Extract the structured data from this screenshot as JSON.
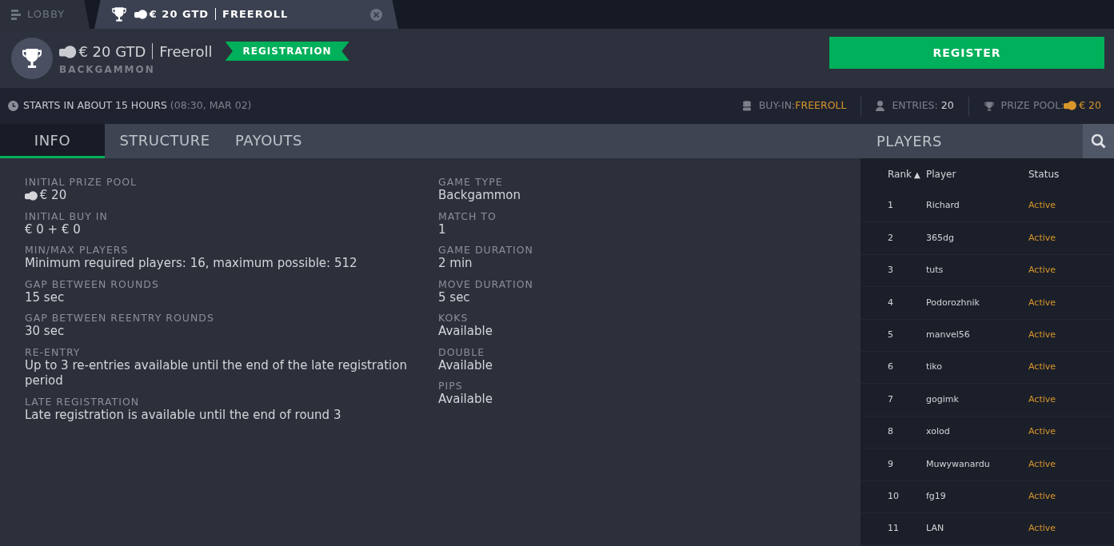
{
  "window_tabs": [
    {
      "kind": "lobby",
      "label": "LOBBY",
      "selected": false
    },
    {
      "kind": "tournament",
      "label": "€ 20 GTD",
      "sublabel": "FREEROLL",
      "selected": true,
      "closable": true
    }
  ],
  "header": {
    "title": "€ 20 GTD",
    "subtitle": "Freeroll",
    "status_badge": "REGISTRATION",
    "game": "BACKGAMMON",
    "register_button": "REGISTER"
  },
  "info_bar": {
    "starts": "STARTS IN ABOUT 15 HOURS",
    "start_time": "(08:30, MAR 02)",
    "buy_in_label": "BUY-IN:",
    "buy_in_value": "FREEROLL",
    "entries_label": "ENTRIES:",
    "entries_value": "20",
    "prize_pool_label": "PRIZE POOL:",
    "prize_pool_value": "€ 20"
  },
  "section_tabs": [
    {
      "label": "INFO",
      "selected": true
    },
    {
      "label": "STRUCTURE",
      "selected": false
    },
    {
      "label": "PAYOUTS",
      "selected": false
    }
  ],
  "info_columns": [
    [
      {
        "label": "INITIAL PRIZE POOL",
        "value": "€ 20",
        "coin": true
      },
      {
        "label": "INITIAL BUY IN",
        "value": "€ 0 + € 0"
      },
      {
        "label": "MIN/MAX PLAYERS",
        "value": "Minimum required players: 16, maximum possible: 512"
      },
      {
        "label": "GAP BETWEEN ROUNDS",
        "value": "15 sec"
      },
      {
        "label": "GAP BETWEEN REENTRY ROUNDS",
        "value": "30 sec"
      },
      {
        "label": "RE-ENTRY",
        "value": "Up to 3 re-entries available until the end of the late registration period"
      },
      {
        "label": "LATE REGISTRATION",
        "value": "Late registration is available until the end of round 3"
      }
    ],
    [
      {
        "label": "GAME TYPE",
        "value": "Backgammon"
      },
      {
        "label": "MATCH TO",
        "value": "1"
      },
      {
        "label": "GAME DURATION",
        "value": "2 min"
      },
      {
        "label": "MOVE DURATION",
        "value": "5 sec"
      },
      {
        "label": "KOKS",
        "value": "Available"
      },
      {
        "label": "DOUBLE",
        "value": "Available"
      },
      {
        "label": "PIPS",
        "value": "Available"
      }
    ]
  ],
  "players": {
    "title": "PLAYERS",
    "columns": [
      "Rank",
      "Player",
      "Status"
    ],
    "sort_indicator": "▲",
    "rows": [
      {
        "rank": "1",
        "player": "Richard",
        "status": "Active"
      },
      {
        "rank": "2",
        "player": "365dg",
        "status": "Active"
      },
      {
        "rank": "3",
        "player": "tuts",
        "status": "Active"
      },
      {
        "rank": "4",
        "player": "Podorozhnik",
        "status": "Active"
      },
      {
        "rank": "5",
        "player": "manvel56",
        "status": "Active"
      },
      {
        "rank": "6",
        "player": "tiko",
        "status": "Active"
      },
      {
        "rank": "7",
        "player": "gogimk",
        "status": "Active"
      },
      {
        "rank": "8",
        "player": "xolod",
        "status": "Active"
      },
      {
        "rank": "9",
        "player": "Muwywanardu",
        "status": "Active"
      },
      {
        "rank": "10",
        "player": "fg19",
        "status": "Active"
      },
      {
        "rank": "11",
        "player": "LAN",
        "status": "Active"
      }
    ]
  }
}
